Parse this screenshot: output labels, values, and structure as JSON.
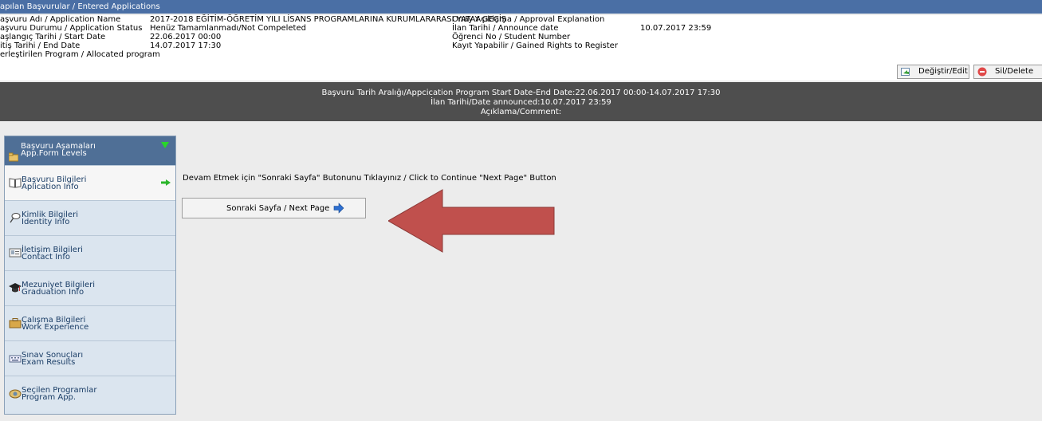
{
  "titlebar": {
    "title": "apılan Başvurular / Entered Applications"
  },
  "info": {
    "application_name_label": "aşvuru Adı / Application Name",
    "application_name_value": "2017-2018 EĞİTİM-ÖĞRETİM YILI LİSANS PROGRAMLARINA KURUMLARARASI YATAY GEÇİŞ",
    "status_label": "aşvuru Durumu / Application Status",
    "status_value": "Henüz Tamamlanmadı/Not Compeleted",
    "start_label": "aşlangıç Tarihi / Start Date",
    "start_value": "22.06.2017 00:00",
    "end_label": "itiş Tarihi / End Date",
    "end_value": "14.07.2017 17:30",
    "allocated_label": "erleştirilen Program / Allocated program",
    "approval_label": "Onay Açıklama / Approval Explanation",
    "announce_label": "İlan Tarihi / Announce date",
    "announce_value": "10.07.2017 23:59",
    "student_no_label": "Öğrenci No / Student Number",
    "register_label": "Kayıt Yapabilir / Gained Rights to Register"
  },
  "actions": {
    "edit_label": "Değiştir/Edit",
    "delete_label": "Sil/Delete"
  },
  "banner": {
    "line1": "Başvuru Tarih Aralığı/Appcication Program Start Date-End Date:22.06.2017 00:00-14.07.2017 17:30",
    "line2": "İlan Tarihi/Date announced:10.07.2017 23:59",
    "line3": "Açıklama/Comment:"
  },
  "sidebar": {
    "header": {
      "line1": "Başvuru Aşamaları",
      "line2": "App.Form Levels"
    },
    "items": [
      {
        "line1": "Başvuru Bilgileri",
        "line2": "Aplication Info",
        "icon": "book-icon"
      },
      {
        "line1": "Kimlik Bilgileri",
        "line2": "Identity Info",
        "icon": "id-icon"
      },
      {
        "line1": "İletişim Bilgileri",
        "line2": "Contact Info",
        "icon": "contact-card-icon"
      },
      {
        "line1": "Mezuniyet Bilgileri",
        "line2": "Graduation Info",
        "icon": "graduation-cap-icon"
      },
      {
        "line1": "Çalışma Bilgileri",
        "line2": "Work Experience",
        "icon": "briefcase-icon"
      },
      {
        "line1": "Sınav Sonuçları",
        "line2": "Exam Results",
        "icon": "keyboard-icon"
      },
      {
        "line1": "Seçilen Programlar",
        "line2": "Program App.",
        "icon": "programs-icon"
      }
    ]
  },
  "main": {
    "instruction": "Devam Etmek için \"Sonraki Sayfa\" Butonunu Tıklayınız / Click to Continue \"Next Page\" Button",
    "next_label": "Sonraki Sayfa / Next Page"
  },
  "colors": {
    "titlebar": "#4a6fa5",
    "banner": "#4e4e4e",
    "sidebar_header": "#4f6f96",
    "arrow": "#c0504d"
  }
}
